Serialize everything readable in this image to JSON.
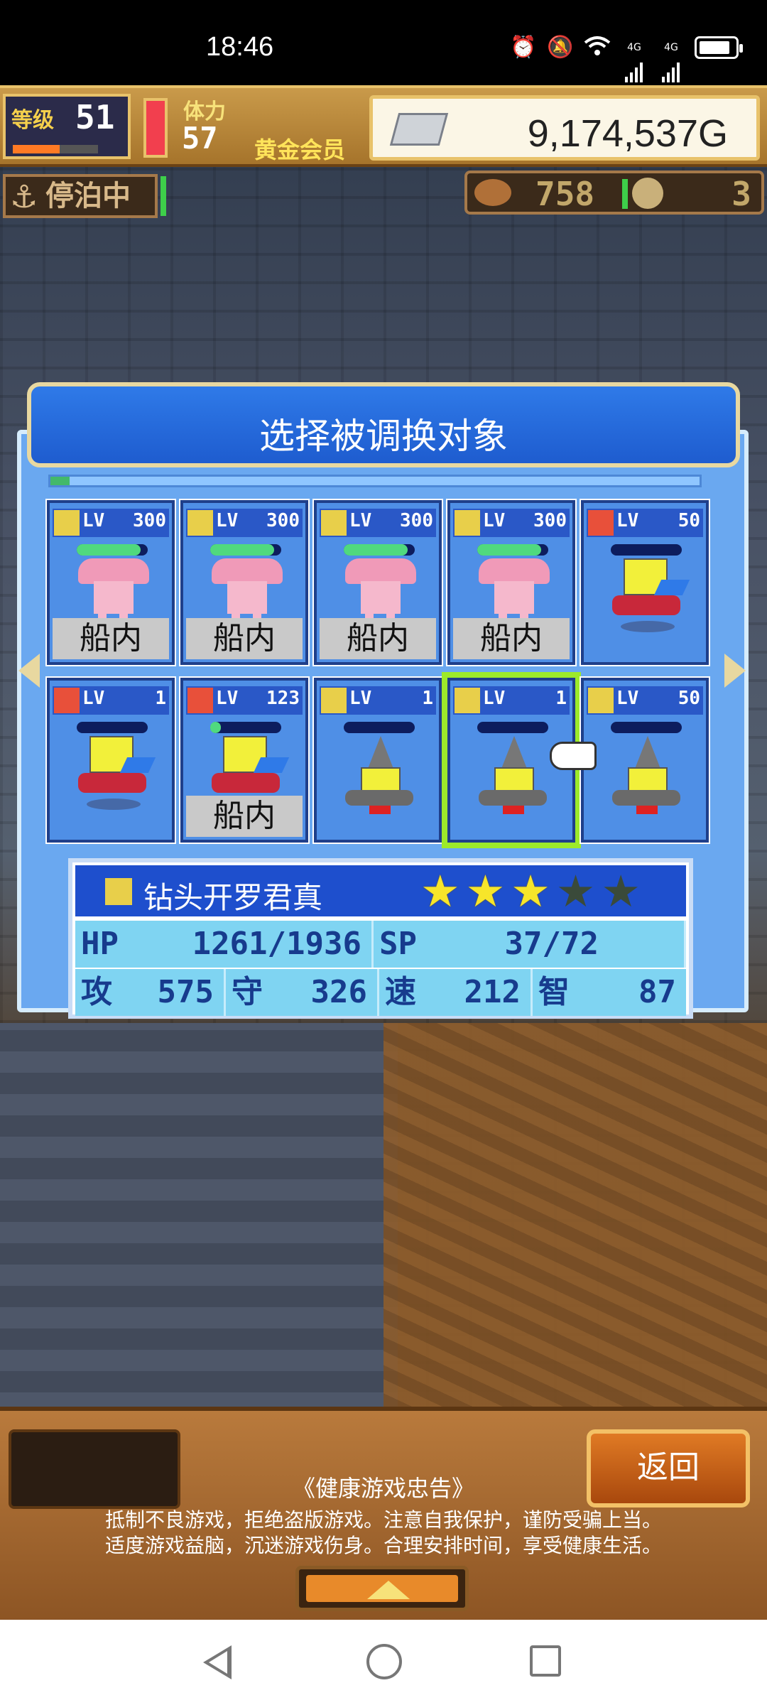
{
  "status_bar": {
    "time": "18:46",
    "signal_labels": [
      "4G",
      "4G"
    ]
  },
  "hud": {
    "level_label": "等级",
    "level_value": "51",
    "stamina_label": "体力",
    "stamina_value": "57",
    "member_label": "黄金会员",
    "gold": "9,174,537G",
    "anchor_status": "停泊中",
    "resource_count_1": "758",
    "resource_count_2": "3"
  },
  "dialog": {
    "title": "选择被调换对象",
    "progress": 0.03
  },
  "cards": [
    {
      "element": "earth",
      "lv_label": "LV",
      "lv": "300",
      "hp": 0.9,
      "sprite": "pink",
      "location": "船内",
      "selected": false
    },
    {
      "element": "earth",
      "lv_label": "LV",
      "lv": "300",
      "hp": 0.9,
      "sprite": "pink",
      "location": "船内",
      "selected": false
    },
    {
      "element": "earth",
      "lv_label": "LV",
      "lv": "300",
      "hp": 0.9,
      "sprite": "pink",
      "location": "船内",
      "selected": false
    },
    {
      "element": "earth",
      "lv_label": "LV",
      "lv": "300",
      "hp": 0.9,
      "sprite": "pink",
      "location": "船内",
      "selected": false
    },
    {
      "element": "fire",
      "lv_label": "LV",
      "lv": "50",
      "hp": 0.0,
      "sprite": "yellow",
      "location": "",
      "selected": false
    },
    {
      "element": "fire",
      "lv_label": "LV",
      "lv": "1",
      "hp": 0.0,
      "sprite": "yellow",
      "location": "",
      "selected": false
    },
    {
      "element": "fire",
      "lv_label": "LV",
      "lv": "123",
      "hp": 0.15,
      "sprite": "yellow",
      "location": "船内",
      "selected": false
    },
    {
      "element": "earth",
      "lv_label": "LV",
      "lv": "1",
      "hp": 0.0,
      "sprite": "drill",
      "location": "",
      "selected": false
    },
    {
      "element": "earth",
      "lv_label": "LV",
      "lv": "1",
      "hp": 0.0,
      "sprite": "drill",
      "location": "",
      "selected": true
    },
    {
      "element": "earth",
      "lv_label": "LV",
      "lv": "50",
      "hp": 0.0,
      "sprite": "drill",
      "location": "",
      "selected": false
    }
  ],
  "selected_unit": {
    "name": "钻头开罗君真",
    "stars_filled": 3,
    "stars_total": 5,
    "stats": {
      "hp_label": "HP",
      "hp_value": "1261/1936",
      "sp_label": "SP",
      "sp_value": "37/72",
      "atk_label": "攻",
      "atk_value": "575",
      "def_label": "守",
      "def_value": "326",
      "spd_label": "速",
      "spd_value": "212",
      "int_label": "智",
      "int_value": "87"
    }
  },
  "bottom": {
    "back_label": "返回",
    "notice_title": "《健康游戏忠告》",
    "notice_line_1": "抵制不良游戏，拒绝盗版游戏。注意自我保护，谨防受骗上当。",
    "notice_line_2": "适度游戏益脑，沉迷游戏伤身。合理安排时间，享受健康生活。"
  },
  "colors": {
    "dialog_header": "#1e5ccf",
    "dialog_body": "#6aa8f0",
    "selected_outline": "#9dea2a",
    "back_button": "#e07a24"
  },
  "icons": {
    "alarm": "alarm-icon",
    "mute": "bell-off-icon",
    "wifi": "wifi-icon",
    "signal": "signal-icon",
    "battery": "battery-icon",
    "anchor": "anchor-icon",
    "silver": "silver-bar-icon",
    "fish": "fish-icon",
    "coin": "coin-icon"
  }
}
